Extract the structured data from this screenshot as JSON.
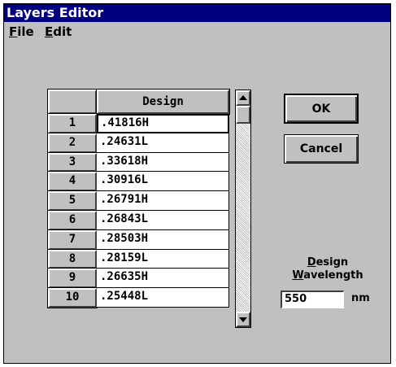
{
  "window": {
    "title": "Layers Editor"
  },
  "menu": {
    "file": {
      "accel": "F",
      "rest": "ile"
    },
    "edit": {
      "accel": "E",
      "rest": "dit"
    }
  },
  "table": {
    "corner": "",
    "column_header": "Design",
    "rows": [
      {
        "num": "1",
        "value": ".41816H"
      },
      {
        "num": "2",
        "value": ".24631L"
      },
      {
        "num": "3",
        "value": ".33618H"
      },
      {
        "num": "4",
        "value": ".30916L"
      },
      {
        "num": "5",
        "value": ".26791H"
      },
      {
        "num": "6",
        "value": ".26843L"
      },
      {
        "num": "7",
        "value": ".28503H"
      },
      {
        "num": "8",
        "value": ".28159L"
      },
      {
        "num": "9",
        "value": ".26635H"
      },
      {
        "num": "10",
        "value": ".25448L"
      }
    ],
    "scroll_up_icon": "arrow-up-icon",
    "scroll_down_icon": "arrow-down-icon"
  },
  "buttons": {
    "ok": "OK",
    "cancel": "Cancel"
  },
  "design_wavelength": {
    "label_line1_accel": "D",
    "label_line1_rest": "esign",
    "label_line2_accel": "W",
    "label_line2_rest": "avelength",
    "value": "550",
    "unit": "nm"
  },
  "colors": {
    "titlebar": "#000080",
    "face": "#c0c0c0"
  }
}
